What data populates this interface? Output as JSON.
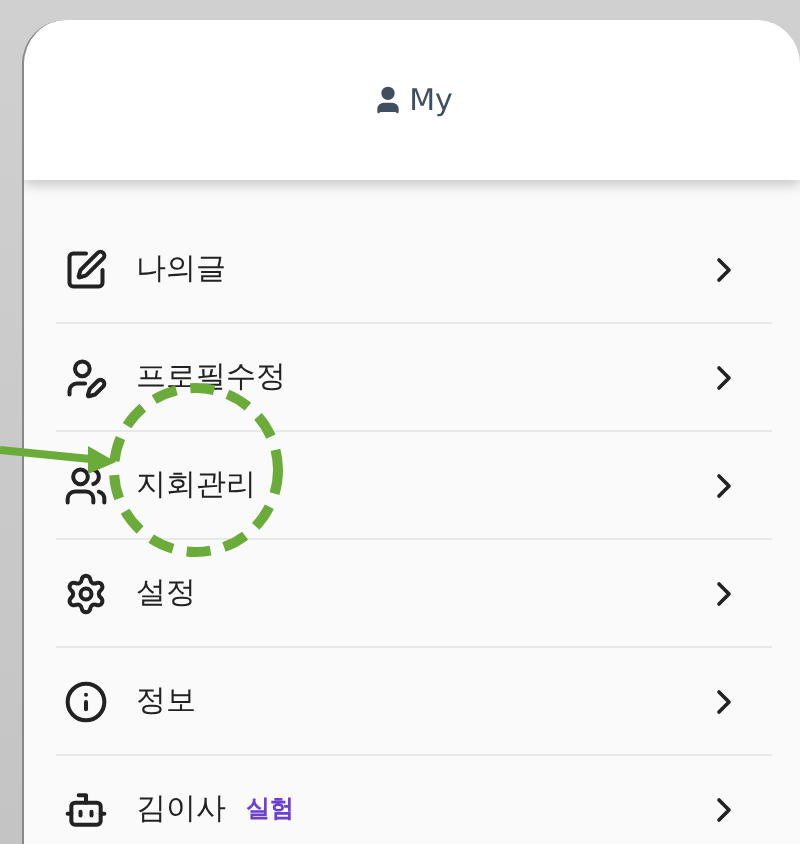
{
  "header": {
    "title": "My"
  },
  "menu": [
    {
      "kind": "edit",
      "label": "나의글"
    },
    {
      "kind": "profile",
      "label": "프로필수정"
    },
    {
      "kind": "group",
      "label": "지회관리"
    },
    {
      "kind": "settings",
      "label": "설정"
    },
    {
      "kind": "info",
      "label": "정보"
    },
    {
      "kind": "bot",
      "label": "김이사",
      "badge": "실험"
    }
  ]
}
